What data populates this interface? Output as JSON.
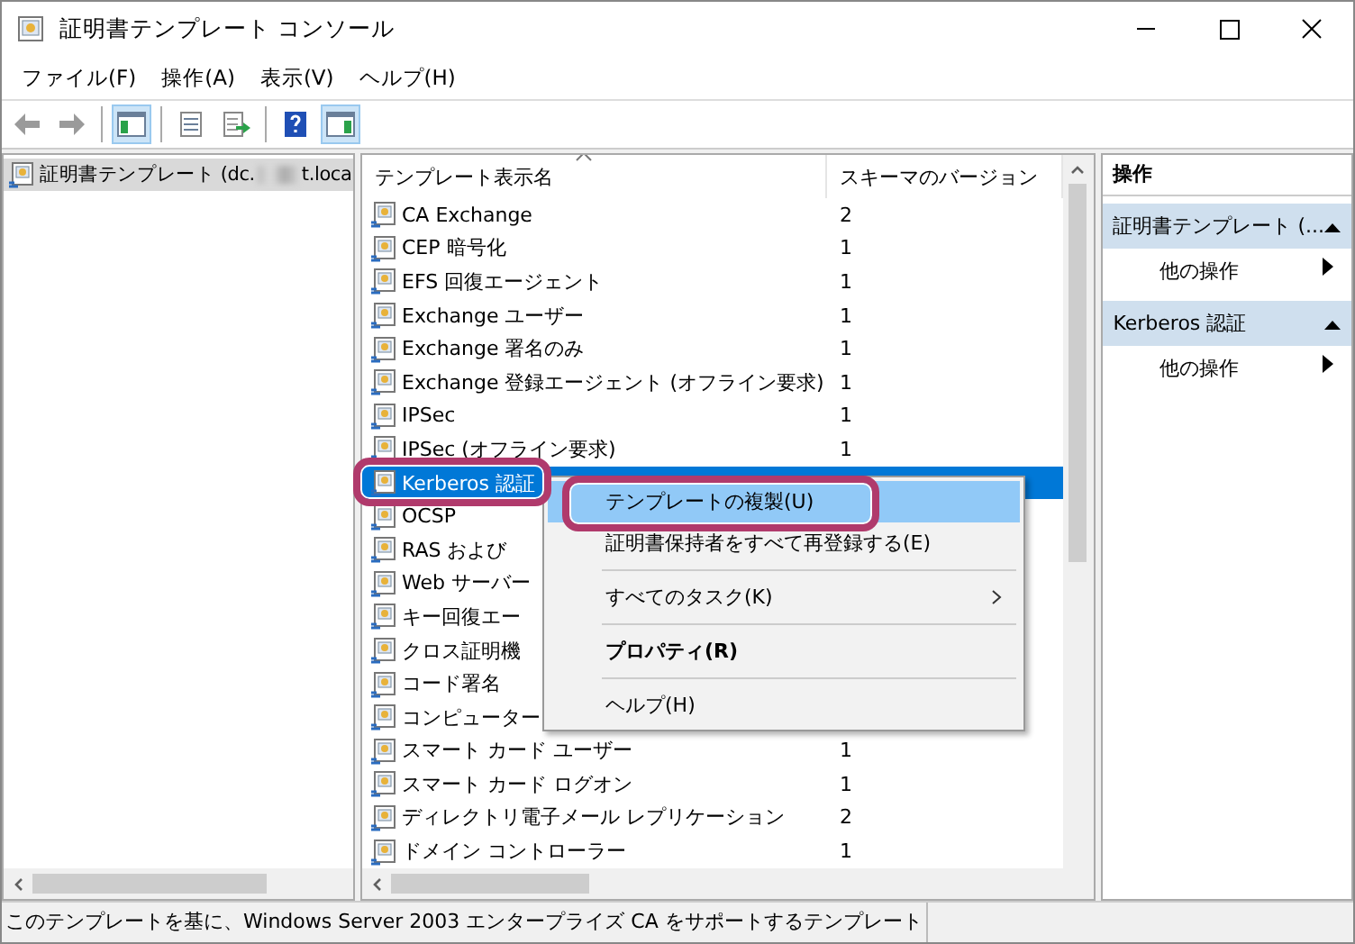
{
  "window": {
    "title": "証明書テンプレート コンソール"
  },
  "menu_bar": [
    "ファイル(F)",
    "操作(A)",
    "表示(V)",
    "ヘルプ(H)"
  ],
  "toolbar": [
    {
      "kind": "back",
      "pressed": false
    },
    {
      "kind": "forward",
      "pressed": false
    },
    {
      "kind": "separator"
    },
    {
      "kind": "tree",
      "pressed": true
    },
    {
      "kind": "separator"
    },
    {
      "kind": "list",
      "pressed": false
    },
    {
      "kind": "export",
      "pressed": false
    },
    {
      "kind": "separator"
    },
    {
      "kind": "help",
      "pressed": false
    },
    {
      "kind": "action_pane",
      "pressed": true
    }
  ],
  "tree": {
    "label_start": "証明書テンプレート (dc.",
    "label_end": "t.loca",
    "selected": true
  },
  "table": {
    "columns": [
      "テンプレート表示名",
      "スキーマのバージョン"
    ],
    "rows": [
      {
        "name": "CA Exchange",
        "version": "2",
        "selected": false
      },
      {
        "name": "CEP 暗号化",
        "version": "1",
        "selected": false
      },
      {
        "name": "EFS 回復エージェント",
        "version": "1",
        "selected": false
      },
      {
        "name": "Exchange ユーザー",
        "version": "1",
        "selected": false
      },
      {
        "name": "Exchange 署名のみ",
        "version": "1",
        "selected": false
      },
      {
        "name": "Exchange 登録エージェント (オフライン要求)",
        "version": "1",
        "selected": false
      },
      {
        "name": "IPSec",
        "version": "1",
        "selected": false
      },
      {
        "name": "IPSec (オフライン要求)",
        "version": "1",
        "selected": false
      },
      {
        "name": "Kerberos 認証",
        "selected": true
      },
      {
        "name": "OCSP",
        "selected": false
      },
      {
        "name": "RAS および",
        "selected": false
      },
      {
        "name": "Web サーバー",
        "selected": false
      },
      {
        "name": "キー回復エー",
        "selected": false
      },
      {
        "name": "クロス証明機",
        "selected": false
      },
      {
        "name": "コード署名",
        "selected": false
      },
      {
        "name": "コンピューター",
        "selected": false
      },
      {
        "name": "スマート カード ユーザー",
        "version": "1",
        "selected": false
      },
      {
        "name": "スマート カード ログオン",
        "version": "1",
        "selected": false
      },
      {
        "name": "ディレクトリ電子メール レプリケーション",
        "version": "2",
        "selected": false
      },
      {
        "name": "ドメイン コントローラー",
        "version": "1",
        "selected": false
      }
    ]
  },
  "context_menu": [
    {
      "kind": "item",
      "label": "テンプレートの複製(U)",
      "selected": true,
      "default": false,
      "submenu": false
    },
    {
      "kind": "item",
      "label": "証明書保持者をすべて再登録する(E)",
      "selected": false,
      "default": false,
      "submenu": false
    },
    {
      "kind": "separator"
    },
    {
      "kind": "item",
      "label": "すべてのタスク(K)",
      "selected": false,
      "default": false,
      "submenu": true
    },
    {
      "kind": "separator"
    },
    {
      "kind": "item",
      "label": "プロパティ(R)",
      "selected": false,
      "default": true,
      "submenu": false
    },
    {
      "kind": "separator"
    },
    {
      "kind": "item",
      "label": "ヘルプ(H)",
      "selected": false,
      "default": false,
      "submenu": false
    }
  ],
  "actions": {
    "title": "操作",
    "sections": [
      {
        "title": "証明書テンプレート (...",
        "items": [
          "他の操作"
        ]
      },
      {
        "title": "Kerberos 認証",
        "items": [
          "他の操作"
        ]
      }
    ]
  },
  "status_bar": "このテンプレートを基に、Windows Server 2003 エンタープライズ CA をサポートするテンプレート"
}
